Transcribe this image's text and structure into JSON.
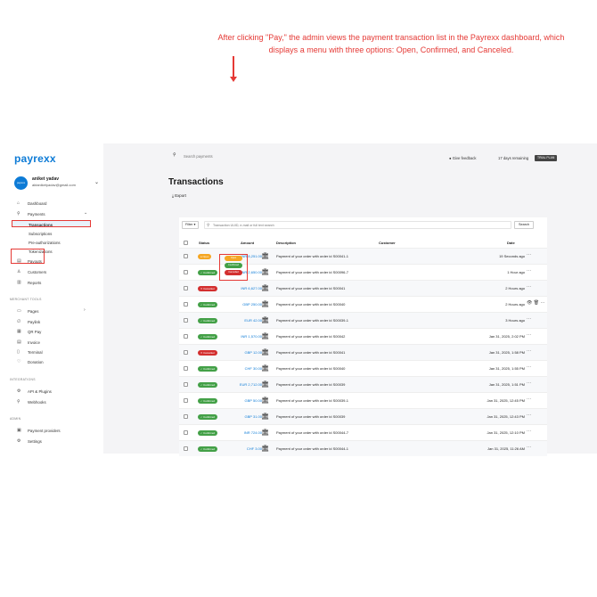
{
  "logo": "payrexx",
  "user": {
    "name": "aniket yadav",
    "email": "aktaniketyadav@gmail.com",
    "avatar_text": "payrexx"
  },
  "nav": {
    "dashboard": "Dashboard",
    "payments": "Payments",
    "transactions": "Transactions",
    "subscriptions": "Subscriptions",
    "preauth": "Pre-authorizations",
    "tokenizations": "Tokenizations",
    "payouts": "Payouts",
    "customers": "Customers",
    "reports": "Reports",
    "merchant_tools_title": "MERCHANT TOOLS",
    "pages": "Pages",
    "paylink": "Paylink",
    "qrpay": "QR Pay",
    "invoice": "Invoice",
    "terminal": "Terminal",
    "donation": "Donation",
    "integrations_title": "INTEGRATIONS",
    "api_plugins": "API & Plugins",
    "webhooks": "Webhooks",
    "admin_title": "ADMIN",
    "payment_providers": "Payment providers",
    "settings": "Settings"
  },
  "topbar": {
    "search_placeholder": "Search payments",
    "feedback": "Give feedback",
    "trial": "17 days remaining",
    "trial_badge": "TRIAL PLAN"
  },
  "page": {
    "title": "Transactions",
    "export": "Export"
  },
  "annotation": "After clicking \"Pay,\" the admin views the payment transaction list in the Payrexx dashboard, which displays a menu with three options: Open, Confirmed, and Canceled.",
  "filter": {
    "button": "Filter ▾",
    "placeholder": "Transaction UUID, e-mail or full text search",
    "search": "Search"
  },
  "table": {
    "headers": {
      "status": "Status",
      "amount": "Amount",
      "description": "Description",
      "customer": "Customer",
      "date": "Date"
    },
    "rows": [
      {
        "status": "Open",
        "status_label": "● Open",
        "amount": "INR 8,251.00",
        "description": "Payment of your order with order id S00041-1",
        "date": "19 Seconds ago",
        "actions": "···"
      },
      {
        "status": "Confirmed",
        "status_label": "✓ Confirmed",
        "amount": "INR 2,650.00",
        "description": "Payment of your order with order id S00096-7",
        "date": "1 Hour ago",
        "actions": "···"
      },
      {
        "status": "Cancelled",
        "status_label": "✕ Cancelled",
        "amount": "INR 6,627.00",
        "description": "Payment of your order with order id S00041",
        "date": "2 Hours ago",
        "actions": "···"
      },
      {
        "status": "Confirmed",
        "status_label": "✓ Confirmed",
        "amount": "GBP 250.00",
        "description": "Payment of your order with order id S00040",
        "date": "2 Hours ago",
        "actions": "👁 🗑 ···"
      },
      {
        "status": "Confirmed",
        "status_label": "✓ Confirmed",
        "amount": "EUR 42.00",
        "description": "Payment of your order with order id S00039-1",
        "date": "3 Hours ago",
        "actions": "···"
      },
      {
        "status": "Confirmed",
        "status_label": "✓ Confirmed",
        "amount": "INR 1,570.00",
        "description": "Payment of your order with order id S00042",
        "date": "Jan 31, 2025, 2:02 PM",
        "actions": "···"
      },
      {
        "status": "Cancelled",
        "status_label": "✕ Cancelled",
        "amount": "GBP 12.00",
        "description": "Payment of your order with order id S00041",
        "date": "Jan 31, 2025, 1:58 PM",
        "actions": "···"
      },
      {
        "status": "Confirmed",
        "status_label": "✓ Confirmed",
        "amount": "CHF 30.00",
        "description": "Payment of your order with order id S00040",
        "date": "Jan 31, 2025, 1:55 PM",
        "actions": "···"
      },
      {
        "status": "Confirmed",
        "status_label": "✓ Confirmed",
        "amount": "EUR 2,712.00",
        "description": "Payment of your order with order id S00039",
        "date": "Jan 31, 2025, 1:51 PM",
        "actions": "···"
      },
      {
        "status": "Confirmed",
        "status_label": "✓ Confirmed",
        "amount": "GBP 50.00",
        "description": "Payment of your order with order id S00039-1",
        "date": "Jan 31, 2025, 12:45 PM",
        "actions": "···"
      },
      {
        "status": "Confirmed",
        "status_label": "✓ Confirmed",
        "amount": "GBP 31.00",
        "description": "Payment of your order with order id S00039",
        "date": "Jan 31, 2025, 12:43 PM",
        "actions": "···"
      },
      {
        "status": "Confirmed",
        "status_label": "✓ Confirmed",
        "amount": "INR 724.00",
        "description": "Payment of your order with order id S00044-7",
        "date": "Jan 31, 2025, 12:10 PM",
        "actions": "···"
      },
      {
        "status": "Confirmed",
        "status_label": "✓ Confirmed",
        "amount": "CHF 3.00",
        "description": "Payment of your order with order id S00044-1",
        "date": "Jan 31, 2025, 11:26 AM",
        "actions": "···"
      }
    ]
  },
  "status_menu": {
    "open": "Open",
    "confirmed": "Confirmed",
    "cancelled": "Cancelled"
  },
  "colors": {
    "brand": "#0d7bd6",
    "confirmed": "#43a047",
    "cancelled": "#d32f2f",
    "open": "#f5a623",
    "annotation": "#e53935"
  }
}
